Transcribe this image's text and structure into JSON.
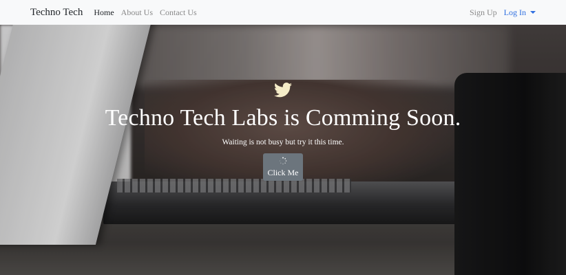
{
  "navbar": {
    "brand": "Techno Tech",
    "links": [
      {
        "label": "Home",
        "active": true
      },
      {
        "label": "About Us",
        "active": false
      },
      {
        "label": "Contact Us",
        "active": false
      }
    ],
    "signup_label": "Sign Up",
    "login_label": "Log In"
  },
  "hero": {
    "icon": "twitter-bird-icon",
    "headline": "Techno Tech Labs is Comming Soon.",
    "tagline": "Waiting is not busy but try it this time.",
    "button_label": "Click Me",
    "button_icon": "loading-spinner-icon"
  },
  "colors": {
    "navbar_bg": "#f8f9fa",
    "link_accent": "#2f6fe0",
    "button_bg": "#6c757d",
    "bird": "#f5ecc8"
  }
}
